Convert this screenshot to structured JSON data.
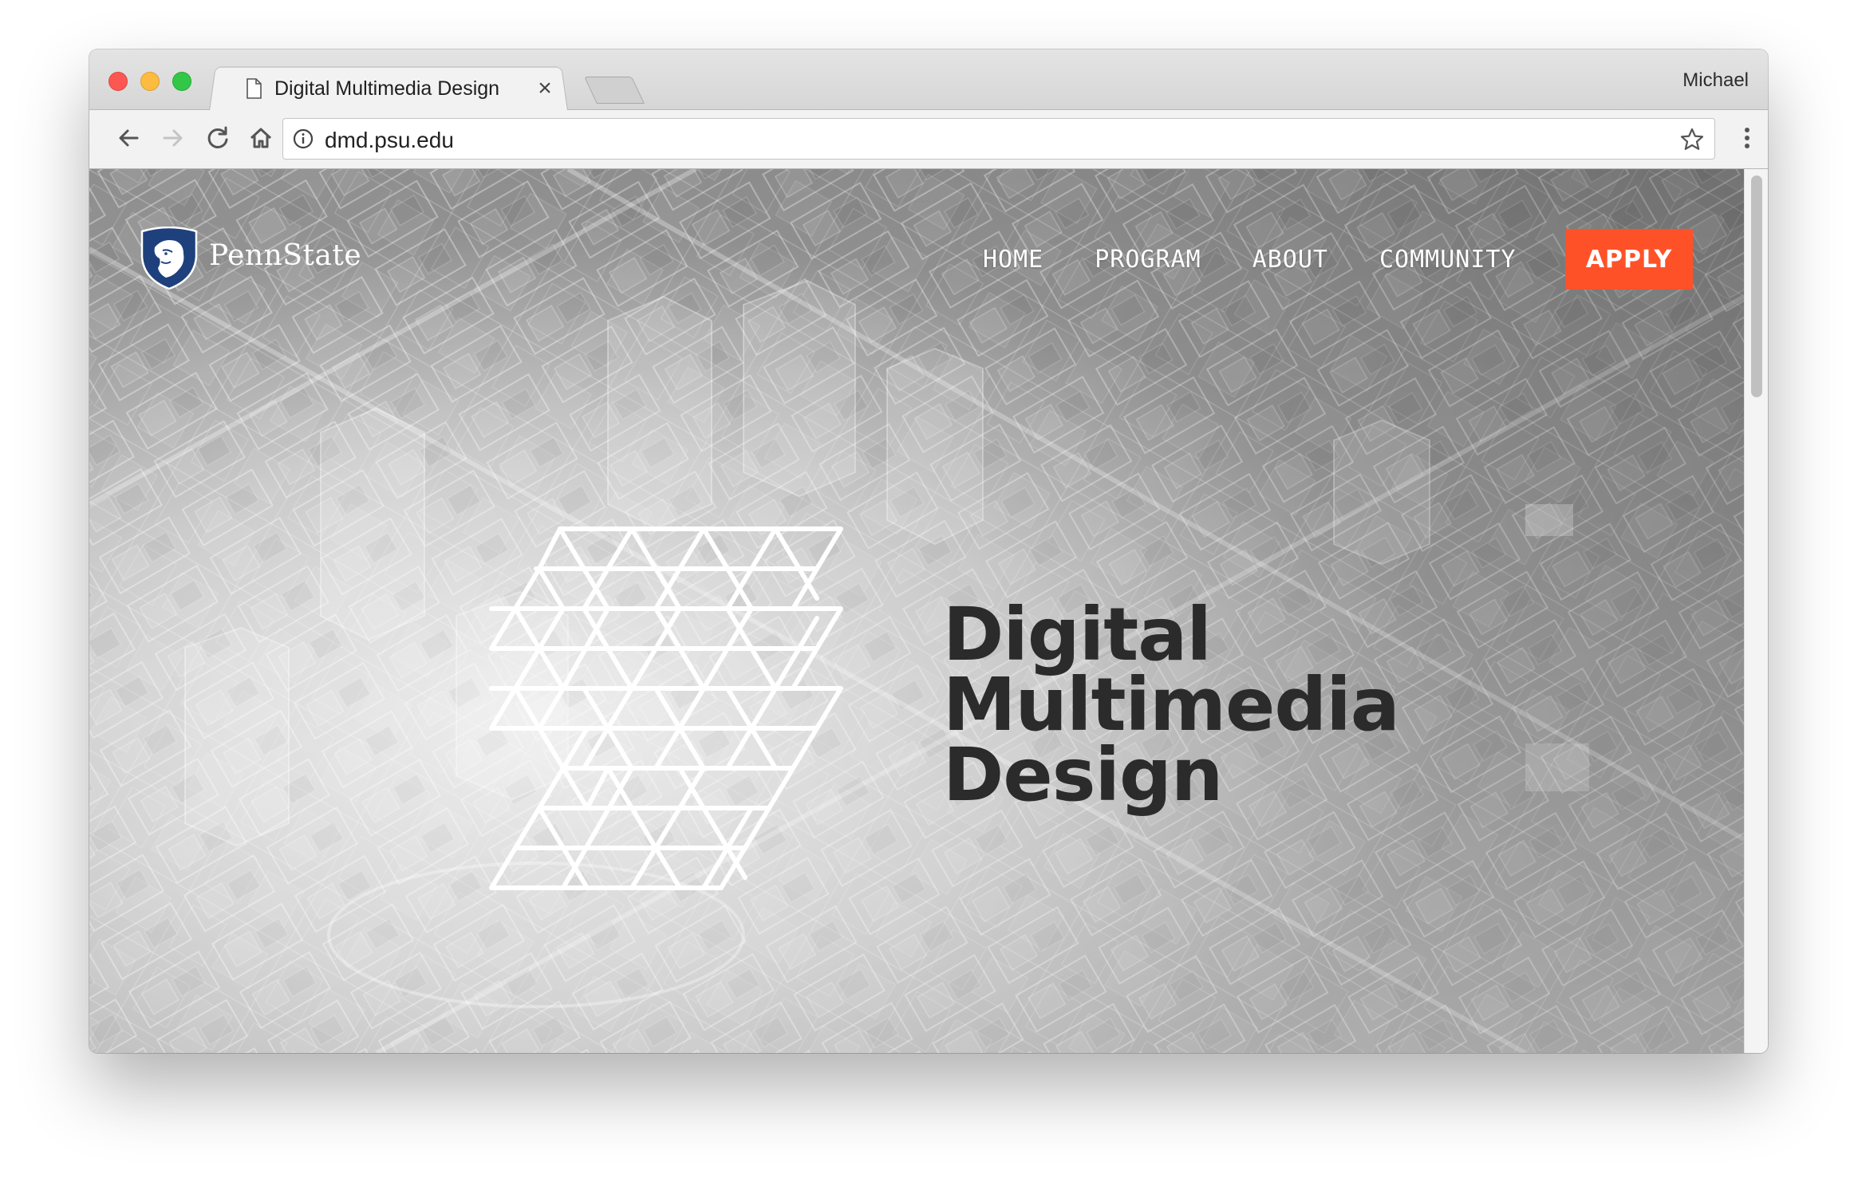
{
  "browser": {
    "tab_title": "Digital Multimedia Design",
    "tab_close": "×",
    "profile_name": "Michael",
    "url": "dmd.psu.edu",
    "icons": {
      "back": "back-arrow-icon",
      "forward": "forward-arrow-icon",
      "reload": "reload-icon",
      "home": "home-icon",
      "site_info": "info-icon",
      "bookmark": "star-icon",
      "menu": "kebab-menu-icon"
    }
  },
  "site": {
    "logo_text": "PennState",
    "nav": {
      "items": [
        "HOME",
        "PROGRAM",
        "ABOUT",
        "COMMUNITY"
      ],
      "apply_label": "APPLY"
    },
    "hero": {
      "title_lines": [
        "Digital",
        "Multimedia",
        "Design"
      ]
    }
  },
  "colors": {
    "apply_button": "#ff5128",
    "hero_text": "#2b2b2b",
    "traffic_red": "#fc5753",
    "traffic_yellow": "#fdbc40",
    "traffic_green": "#33c748",
    "shield_blue": "#1e407c"
  }
}
